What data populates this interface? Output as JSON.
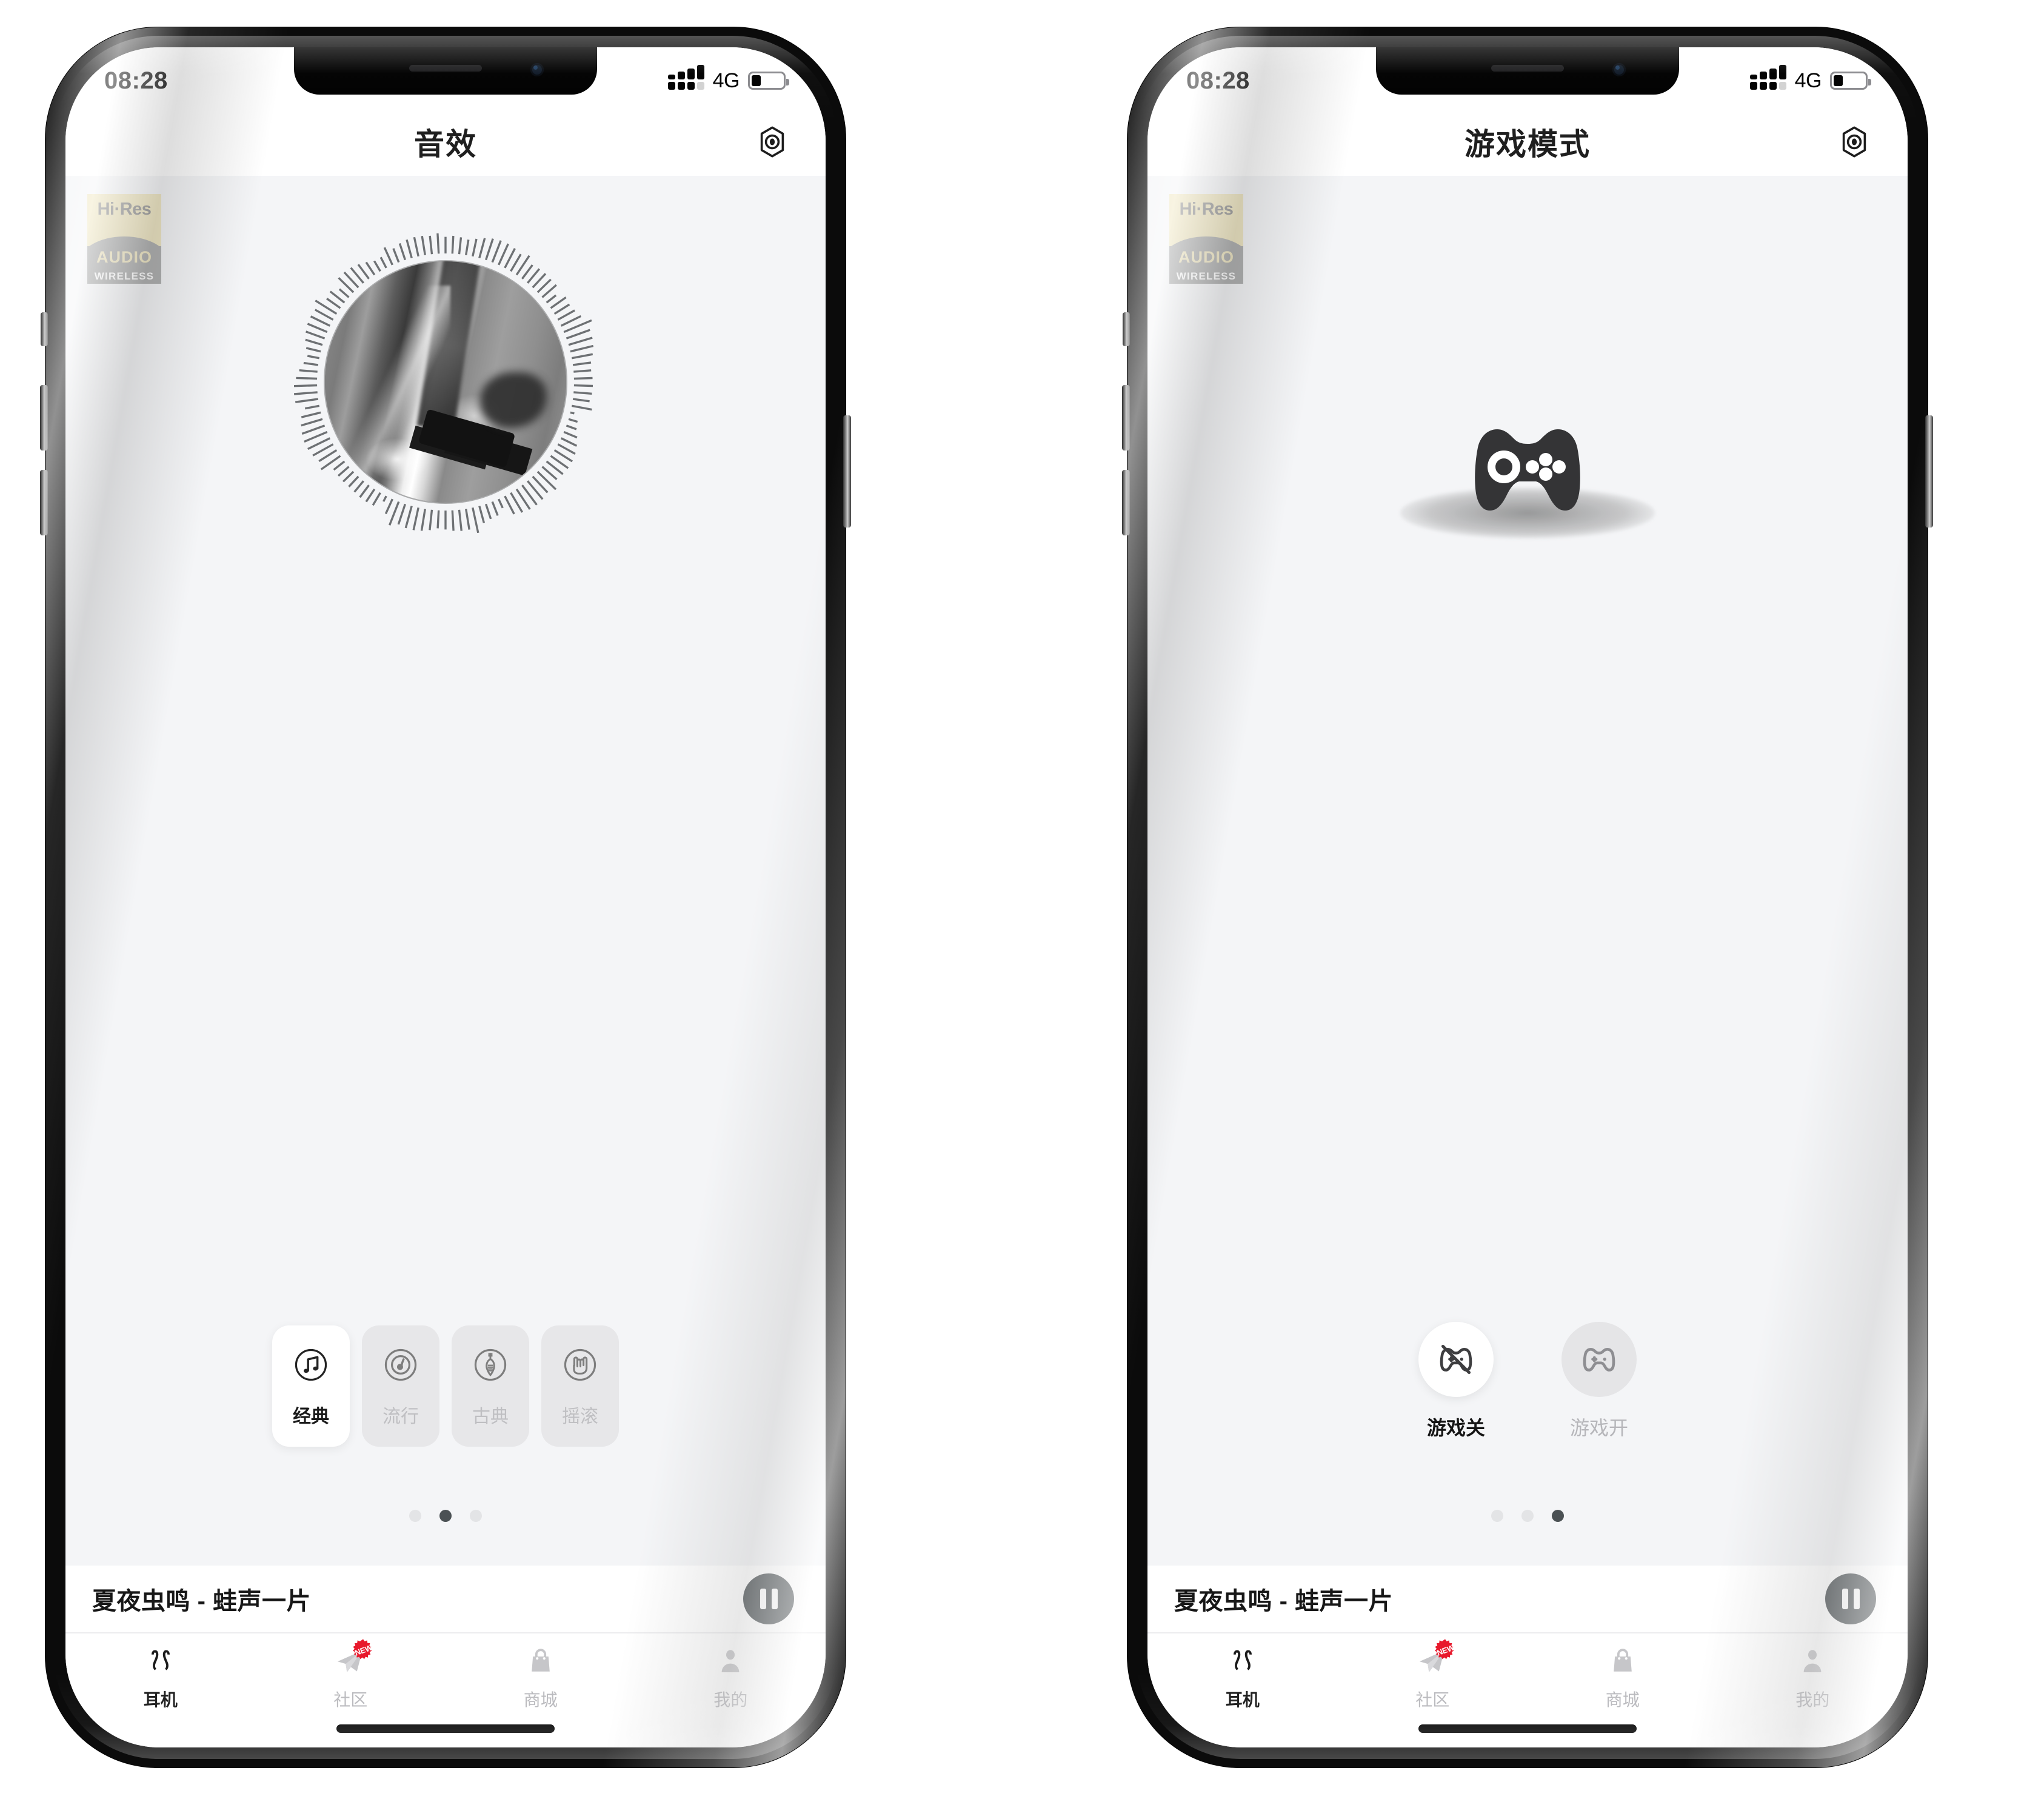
{
  "phones": [
    {
      "id": "sound-effects",
      "statusbar": {
        "time": "08:28",
        "network": "4G",
        "battery_level": "30"
      },
      "navbar": {
        "title": "音效",
        "action_icon": "settings-hexagon-icon"
      },
      "hires_badge": {
        "line1": "Hi·Res",
        "line2": "AUDIO",
        "line3": "WIRELESS"
      },
      "artwork": {
        "alt": "turntable-stylus-photo",
        "visualizer": "circular-waveform"
      },
      "presets": [
        {
          "label": "经典",
          "icon": "music-note-circle-icon",
          "active": true
        },
        {
          "label": "流行",
          "icon": "vinyl-disc-circle-icon",
          "active": false
        },
        {
          "label": "古典",
          "icon": "pipa-lute-circle-icon",
          "active": false
        },
        {
          "label": "摇滚",
          "icon": "rock-hand-circle-icon",
          "active": false
        }
      ],
      "page_dots": {
        "count": 3,
        "active_index": 1
      },
      "now_playing": {
        "title": "夏夜虫鸣 - 蛙声一片",
        "button_icon": "pause-icon",
        "state": "playing"
      },
      "tabs": [
        {
          "label": "耳机",
          "icon": "earbuds-icon",
          "active": true,
          "badge": ""
        },
        {
          "label": "社区",
          "icon": "paper-plane-icon",
          "active": false,
          "badge": "NEW"
        },
        {
          "label": "商城",
          "icon": "shopping-bag-icon",
          "active": false,
          "badge": ""
        },
        {
          "label": "我的",
          "icon": "user-icon",
          "active": false,
          "badge": ""
        }
      ]
    },
    {
      "id": "game-mode",
      "statusbar": {
        "time": "08:28",
        "network": "4G",
        "battery_level": "30"
      },
      "navbar": {
        "title": "游戏模式",
        "action_icon": "settings-hexagon-icon"
      },
      "hires_badge": {
        "line1": "Hi·Res",
        "line2": "AUDIO",
        "line3": "WIRELESS"
      },
      "illustration": {
        "icon": "gamepad-icon"
      },
      "game_options": [
        {
          "label": "游戏关",
          "icon": "gamepad-off-icon",
          "active": true
        },
        {
          "label": "游戏开",
          "icon": "gamepad-on-icon",
          "active": false
        }
      ],
      "page_dots": {
        "count": 3,
        "active_index": 2
      },
      "now_playing": {
        "title": "夏夜虫鸣 - 蛙声一片",
        "button_icon": "pause-icon",
        "state": "playing"
      },
      "tabs": [
        {
          "label": "耳机",
          "icon": "earbuds-icon",
          "active": true,
          "badge": ""
        },
        {
          "label": "社区",
          "icon": "paper-plane-icon",
          "active": false,
          "badge": "NEW"
        },
        {
          "label": "商城",
          "icon": "shopping-bag-icon",
          "active": false,
          "badge": ""
        },
        {
          "label": "我的",
          "icon": "user-icon",
          "active": false,
          "badge": ""
        }
      ]
    }
  ],
  "colors": {
    "page_background": "#f4f5f7",
    "surface": "#ffffff",
    "accent_dark": "#4b5154",
    "muted_text": "#b9b9bd",
    "badge_red": "#e8192c",
    "hires_cream": "#efe6bd",
    "hires_gray": "#a6a6a6"
  }
}
